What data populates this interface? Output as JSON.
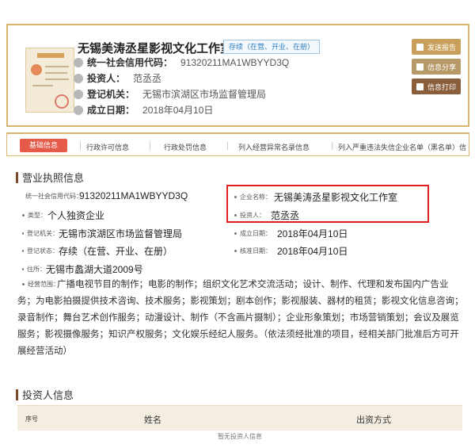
{
  "company": {
    "name": "无锡美涛丞星影视文化工作室",
    "status_badge": "存续（在营、开业、在册）",
    "credit_code_label": "统一社会信用代码：",
    "credit_code": "91320211MA1WBYYD3Q",
    "investor_label": "投资人：",
    "investor": "范丞丞",
    "authority_label": "登记机关：",
    "authority": "无锡市滨湖区市场监督管理局",
    "established_label": "成立日期：",
    "established": "2018年04月10日"
  },
  "actions": {
    "report": "发送报告",
    "share": "信息分享",
    "print": "信息打印"
  },
  "tabs": [
    {
      "label": "基础信息"
    },
    {
      "label": "行政许可信息"
    },
    {
      "label": "行政处罚信息"
    },
    {
      "label": "列入经营异常名录信息"
    },
    {
      "label": "列入严重违法失信企业名单（黑名单）信"
    }
  ],
  "license_section": {
    "title": "营业执照信息",
    "fields": {
      "credit_code_label": "统一社会信用代码：",
      "credit_code": "91320211MA1WBYYD3Q",
      "name_label": "企业名称：",
      "name": "无锡美涛丞星影视文化工作室",
      "type_label": "类型：",
      "type": "个人独资企业",
      "investor_label": "投资人：",
      "investor": "范丞丞",
      "authority_label": "登记机关：",
      "authority": "无锡市滨湖区市场监督管理局",
      "established_label": "成立日期：",
      "established": "2018年04月10日",
      "status_label": "登记状态：",
      "status": "存续（在营、开业、在册）",
      "approved_label": "核准日期：",
      "approved": "2018年04月10日",
      "address_label": "住所：",
      "address": "无锡市蠡湖大道2009号",
      "scope_label": "经营范围：",
      "scope": "广播电视节目的制作；电影的制作；组织文化艺术交流活动；设计、制作、代理和发布国内广告业务；为电影拍摄提供技术咨询、技术服务；影视策划；剧本创作；影视服装、器材的租赁；影视文化信息咨询；录音制作；舞台艺术创作服务；动漫设计、制作（不含画片摄制）；企业形象策划；市场营销策划；会议及展览服务；影视摄像服务；知识产权服务；文化娱乐经纪人服务。（依法须经批准的项目，经相关部门批准后方可开展经营活动）"
    }
  },
  "investor_section": {
    "title": "投资人信息",
    "columns": [
      "序号",
      "姓名",
      "出资方式"
    ],
    "empty_text": "暂无投资人信息"
  },
  "colors": {
    "accent_gold": "#d9b66c",
    "active_tab": "#e65a4a",
    "highlight_red": "#e21f1f",
    "brown": "#7a4a2b"
  }
}
